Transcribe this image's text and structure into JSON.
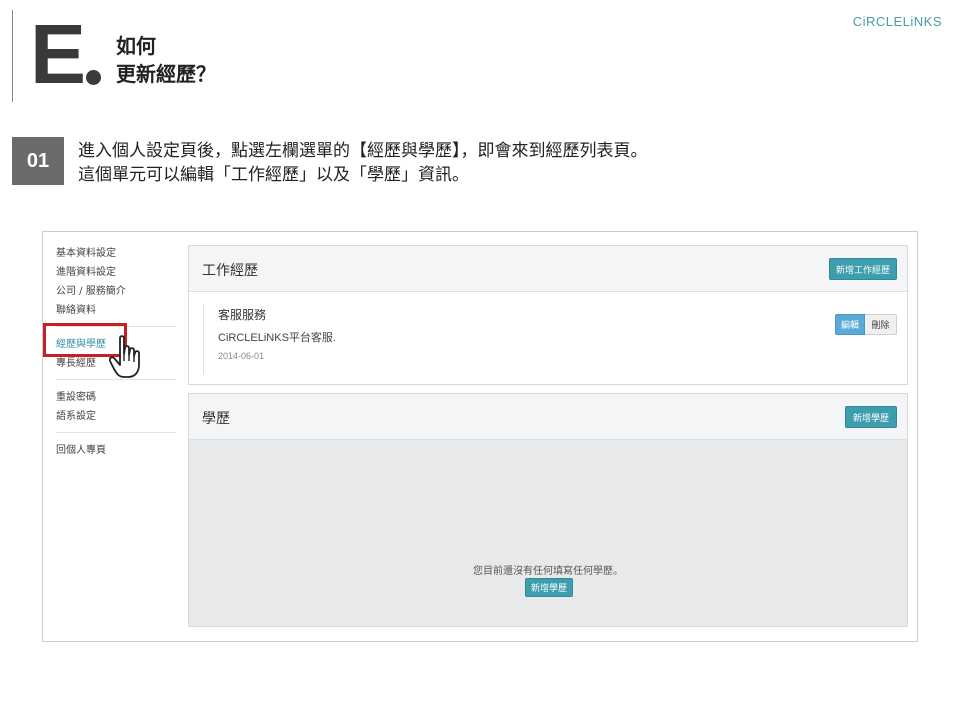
{
  "header": {
    "letter": "E",
    "title_line1": "如何",
    "title_line2": "更新經歷？",
    "logo": "CiRCLELiNKS"
  },
  "step": {
    "number": "01",
    "line1": "進入個人設定頁後，點選左欄選單的【經歷與學歷】，即會來到經歷列表頁。",
    "line2": "這個單元可以編輯「工作經歷」以及「學歷」資訊。"
  },
  "sidebar": {
    "group1": [
      "基本資料設定",
      "進階資料設定",
      "公司 / 服務簡介",
      "聯絡資料"
    ],
    "group2": [
      "經歷與學歷",
      "專長經歷"
    ],
    "group3": [
      "重設密碼",
      "語系設定"
    ],
    "group4": [
      "回個人專頁"
    ]
  },
  "work_panel": {
    "title": "工作經歷",
    "add_label": "新增工作經歷",
    "entry": {
      "title": "客服服務",
      "desc": "CiRCLELiNKS平台客服.",
      "date": "2014-06-01",
      "edit_label": "編輯",
      "delete_label": "刪除"
    }
  },
  "edu_panel": {
    "title": "學歷",
    "add_label": "新增學歷",
    "empty_message": "您目前還沒有任何填寫任何學歷。",
    "empty_add_label": "新增學歷"
  },
  "colors": {
    "accent": "#3e9eae",
    "highlight": "#c81e24",
    "badge": "#6b6b6b"
  }
}
